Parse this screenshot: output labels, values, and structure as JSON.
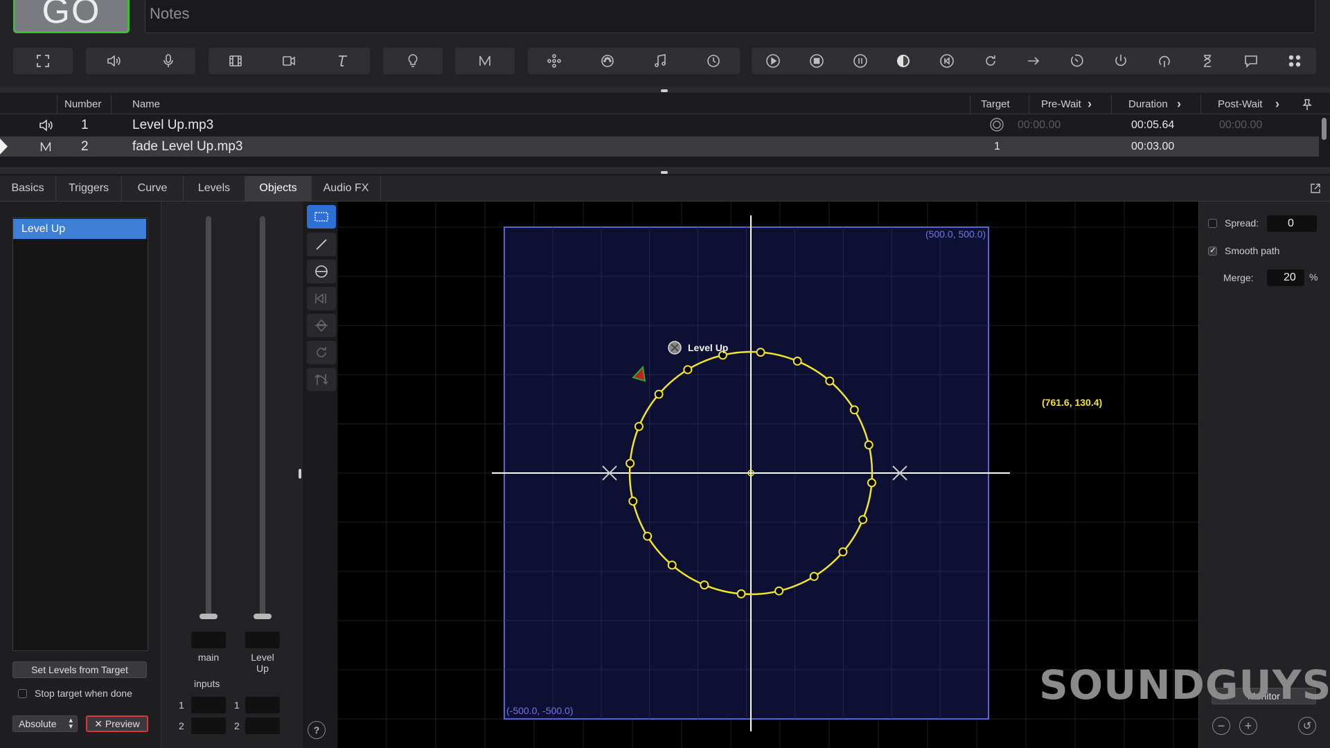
{
  "top": {
    "go_label": "GO",
    "notes_placeholder": "Notes",
    "toolbar_groups": [
      [
        "fullscreen-icon"
      ],
      [
        "audio-cue-icon",
        "mic-cue-icon"
      ],
      [
        "video-cue-icon",
        "camera-cue-icon",
        "text-cue-icon"
      ],
      [
        "light-cue-icon"
      ],
      [
        "fade-cue-icon"
      ],
      [
        "network-cue-icon",
        "midi-cue-icon",
        "music-cue-icon",
        "timecode-cue-icon"
      ],
      [
        "start-cue-icon",
        "stop-cue-icon",
        "pause-cue-icon",
        "load-cue-icon",
        "reset-cue-icon",
        "devamp-cue-icon",
        "goto-cue-icon",
        "target-cue-icon",
        "arm-cue-icon",
        "disarm-cue-icon",
        "wait-cue-icon",
        "memo-cue-icon",
        "script-cue-icon"
      ]
    ]
  },
  "cue_list": {
    "columns": {
      "number": "Number",
      "name": "Name",
      "target": "Target",
      "prewait": "Pre-Wait",
      "duration": "Duration",
      "postwait": "Post-Wait"
    },
    "rows": [
      {
        "number": "1",
        "name": "Level Up.mp3",
        "target": "",
        "prewait": "00:00.00",
        "duration": "00:05.64",
        "postwait": "00:00.00",
        "type": "audio"
      },
      {
        "number": "2",
        "name": "fade Level Up.mp3",
        "target": "1",
        "prewait": "",
        "duration": "00:03.00",
        "postwait": "",
        "type": "fade"
      }
    ]
  },
  "tabs": [
    "Basics",
    "Triggers",
    "Curve",
    "Levels",
    "Objects",
    "Audio FX"
  ],
  "active_tab": "Objects",
  "left_panel": {
    "objects": [
      "Level Up"
    ],
    "set_levels_button": "Set Levels from Target",
    "stop_target_label": "Stop target when done",
    "mode_select": "Absolute",
    "preview_button": "✕ Preview"
  },
  "levels": {
    "fader_main_label": "main",
    "fader_object_label": "Level Up",
    "inputs_label": "inputs",
    "input_rows": [
      "1",
      "2"
    ]
  },
  "canvas": {
    "top_right_coord": "(500.0, 500.0)",
    "bottom_left_coord": "(-500.0, -500.0)",
    "cursor_coord": "(761.6, 130.4)",
    "object_name": "Level Up",
    "colors": {
      "room_fill": "#0d1033",
      "room_border": "#5a64d8",
      "path": "#f2e62a",
      "axes": "#ffffff"
    }
  },
  "right_panel": {
    "spread_label": "Spread:",
    "spread_value": "0",
    "smooth_label": "Smooth path",
    "merge_label": "Merge:",
    "merge_value": "20",
    "merge_unit": "%",
    "monitor_button": "Monitor"
  },
  "watermark": "SOUNDGUYS"
}
